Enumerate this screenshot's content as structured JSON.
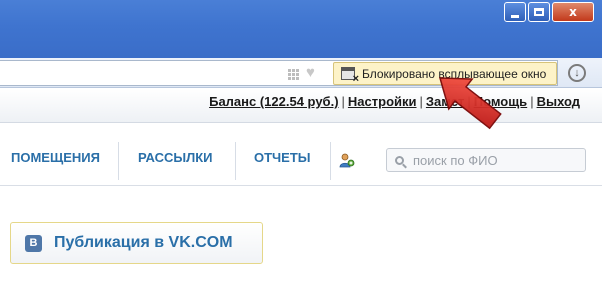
{
  "window": {
    "minimize_icon": "minimize-icon",
    "maximize_icon": "maximize-icon",
    "close_label": "x"
  },
  "browser": {
    "popup_blocked_text": "Блокировано всплывающее окно",
    "icons": [
      "apps-grid-icon",
      "heart-icon",
      "popup-blocked-icon",
      "download-icon"
    ]
  },
  "toplinks": {
    "balance": "Баланс (122.54 руб.)",
    "settings": "Настройки",
    "notes": "Замет",
    "help": "Помощь",
    "logout": "Выход"
  },
  "menu": {
    "items": [
      "ПОМЕЩЕНИЯ",
      "РАССЫЛКИ",
      "ОТЧЕТЫ"
    ],
    "search_placeholder": "поиск по ФИО"
  },
  "vk": {
    "logo_text": "В",
    "label": "Публикация в VK.COM"
  },
  "colors": {
    "titlebar": "#3f74cf",
    "link_blue": "#2a6fa8",
    "notice_bg": "#fdf3c8",
    "arrow_red": "#d11a1a"
  }
}
